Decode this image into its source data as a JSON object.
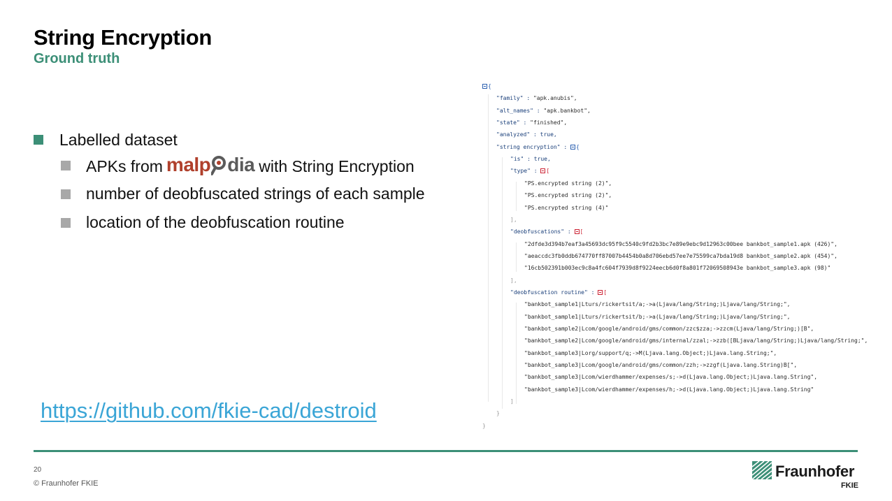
{
  "slide": {
    "title": "String Encryption",
    "subtitle": "Ground truth"
  },
  "bullets": {
    "main": "Labelled dataset",
    "sub1_before": "APKs from",
    "sub1_logo": {
      "part1": "malp",
      "part2": "dia",
      "colors": {
        "accent": "#b0402c",
        "dark": "#5b5b5b"
      }
    },
    "sub1_after": "with String Encryption",
    "sub2": "number of deobfuscated strings of each sample",
    "sub3": "location of the deobfuscation routine"
  },
  "link": "https://github.com/fkie-cad/destroid",
  "json_view": {
    "lines": [
      "{",
      "\"family\" : \"apk.anubis\",",
      "\"alt_names\" : \"apk.bankbot\",",
      "\"state\" : \"finished\",",
      "\"analyzed\" : true,",
      "\"string encryption\" : {",
      "\"is\" : true,",
      "\"type\" : [",
      "\"PS.encrypted string (2)\",",
      "\"PS.encrypted string (2)\",",
      "\"PS.encrypted string (4)\"",
      "],",
      "\"deobfuscations\" : [",
      "\"2dfde3d394b7eaf3a45693dc95f9c5540c9fd2b3bc7e89e9ebc9d12963c00bee bankbot_sample1.apk (426)\",",
      "\"aeaccdc3fb0ddb674770ff87007b4454b0a8d706ebd57ee7e75599ca7bda19d8 bankbot_sample2.apk (454)\",",
      "\"16cb502391b003ec9c8a4fc604f7939d8f9224eecb6d0f8a801f72069508943e bankbot_sample3.apk (98)\"",
      "],",
      "\"deobfuscation routine\" : [",
      "\"bankbot_sample1|Lturs/rickertsit/a;->a(Ljava/lang/String;)Ljava/lang/String;\",",
      "\"bankbot_sample1|Lturs/rickertsit/b;->a(Ljava/lang/String;)Ljava/lang/String;\",",
      "\"bankbot_sample2|Lcom/google/android/gms/common/zzc$zza;->zzcm(Ljava/lang/String;)[B\",",
      "\"bankbot_sample2|Lcom/google/android/gms/internal/zzal;->zzb([BLjava/lang/String;)Ljava/lang/String;\",",
      "\"bankbot_sample3|Lorg/support/q;->M(Ljava.lang.Object;)Ljava.lang.String;\",",
      "\"bankbot_sample3|Lcom/google/android/gms/common/zzh;->zzgf(Ljava.lang.String)B[\",",
      "\"bankbot_sample3|Lcom/wierdhammer/expenses/s;->d(Ljava.lang.Object;)Ljava.lang.String\",",
      "\"bankbot_sample3|Lcom/wierdhammer/expenses/h;->d(Ljava.lang.Object;)Ljava.lang.String\"",
      "]",
      "}",
      "}"
    ]
  },
  "footer": {
    "page_number": "20",
    "copyright": "© Fraunhofer FKIE",
    "org_name": "Fraunhofer",
    "org_unit": "FKIE"
  },
  "colors": {
    "accent_green": "#3c8f77",
    "link_blue": "#3aa5d6",
    "bullet_gray": "#a8a8a8"
  }
}
